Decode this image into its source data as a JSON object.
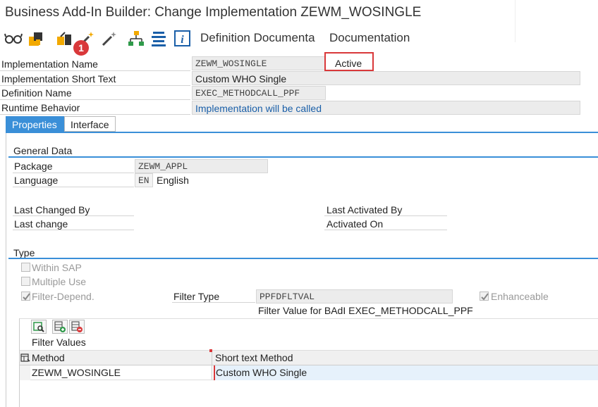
{
  "window": {
    "title": "Business Add-In Builder: Change Implementation ZEWM_WOSINGLE"
  },
  "toolbar": {
    "icons": [
      "glasses-icon",
      "transport-icon",
      "other-object-icon",
      "activate-wand-icon",
      "deactivate-wand-icon",
      "hierarchy-icon",
      "list-icon",
      "info-icon"
    ],
    "badge": "1",
    "definition_doc_label": "Definition Documenta",
    "documentation_label": "Documentation"
  },
  "header": {
    "impl_name_label": "Implementation Name",
    "impl_name_value": "ZEWM_WOSINGLE",
    "status": "Active",
    "short_text_label": "Implementation Short Text",
    "short_text_value": "Custom WHO Single",
    "def_name_label": "Definition Name",
    "def_name_value": "EXEC_METHODCALL_PPF",
    "runtime_label": "Runtime Behavior",
    "runtime_value": "Implementation will be called"
  },
  "tabs": [
    {
      "label": "Properties",
      "active": true
    },
    {
      "label": "Interface",
      "active": false
    }
  ],
  "general": {
    "title": "General Data",
    "package_label": "Package",
    "package_value": "ZEWM_APPL",
    "language_label": "Language",
    "language_code": "EN",
    "language_text": "English",
    "last_changed_by_label": "Last Changed By",
    "last_change_label": "Last change",
    "last_activated_by_label": "Last Activated By",
    "activated_on_label": "Activated On"
  },
  "type": {
    "title": "Type",
    "within_sap": "Within SAP",
    "multiple_use": "Multiple Use",
    "filter_depend": "Filter-Depend.",
    "filter_type_label": "Filter Type",
    "filter_type_value": "PPFDFLTVAL",
    "enhanceable": "Enhanceable",
    "filter_value_caption": "Filter Value for BAdI EXEC_METHODCALL_PPF"
  },
  "filter_table": {
    "title": "Filter Values",
    "col_method": "Method",
    "col_short": "Short text Method",
    "rows": [
      {
        "method": "ZEWM_WOSINGLE",
        "short": "Custom WHO Single"
      }
    ]
  },
  "colors": {
    "accent": "#3a8fd8",
    "status_border": "#d9383a",
    "badge": "#d9383a"
  }
}
